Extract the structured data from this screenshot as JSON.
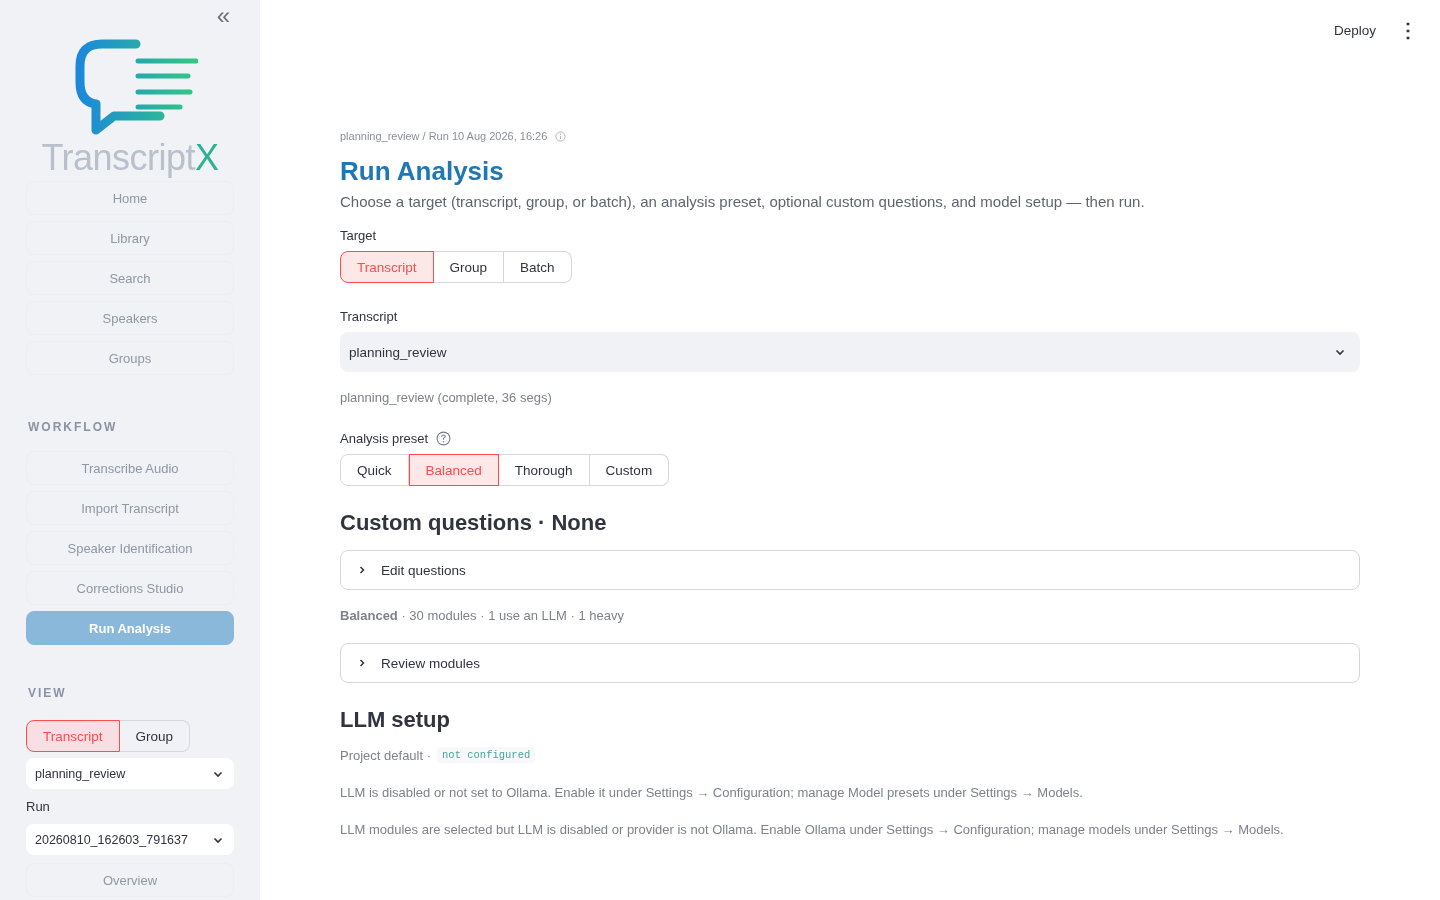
{
  "sidebar": {
    "collapse_icon": "«",
    "logo": {
      "wordmark": "Transcript",
      "accent": "X"
    },
    "nav": [
      {
        "label": "Home",
        "selected": false
      },
      {
        "label": "Library",
        "selected": false
      },
      {
        "label": "Search",
        "selected": false
      },
      {
        "label": "Speakers",
        "selected": false
      },
      {
        "label": "Groups",
        "selected": false
      }
    ],
    "workflow": {
      "title": "WORKFLOW",
      "items": [
        {
          "label": "Transcribe Audio",
          "selected": false
        },
        {
          "label": "Import Transcript",
          "selected": false
        },
        {
          "label": "Speaker Identification",
          "selected": false
        },
        {
          "label": "Corrections Studio",
          "selected": false
        },
        {
          "label": "Run Analysis",
          "selected": true
        }
      ]
    },
    "view": {
      "title": "VIEW",
      "tabs": [
        {
          "label": "Transcript",
          "selected": true
        },
        {
          "label": "Group",
          "selected": false
        }
      ],
      "transcript_select": "planning_review",
      "run_label": "Run",
      "run_select": "20260810_162603_791637",
      "next_item": "Overview"
    }
  },
  "header": {
    "deploy": "Deploy",
    "menu_icon": "⋮"
  },
  "breadcrumb": "planning_review / Run 10 Aug 2026, 16:26",
  "title": "Run Analysis",
  "subtitle": "Choose a target (transcript, group, or batch), an analysis preset, optional custom questions, and model setup — then run.",
  "target": {
    "label": "Target",
    "options": [
      {
        "label": "Transcript",
        "selected": true
      },
      {
        "label": "Group",
        "selected": false
      },
      {
        "label": "Batch",
        "selected": false
      }
    ]
  },
  "transcript": {
    "label": "Transcript",
    "value": "planning_review",
    "caption": "planning_review (complete, 36 segs)"
  },
  "preset": {
    "label": "Analysis preset",
    "options": [
      {
        "label": "Quick",
        "selected": false
      },
      {
        "label": "Balanced",
        "selected": true
      },
      {
        "label": "Thorough",
        "selected": false
      },
      {
        "label": "Custom",
        "selected": false
      }
    ]
  },
  "custom_questions": {
    "heading": "Custom questions · None",
    "expander": {
      "label": "Edit questions",
      "expanded": false
    }
  },
  "summary": "**Balanced** · 30 modules · 1 use an LLM · 1 heavy",
  "modules_expander": {
    "label": "Review modules",
    "expanded": false
  },
  "llm": {
    "heading": "LLM setup",
    "project_default": "Project default ·",
    "status_code": "not configured",
    "notes": [
      "LLM is disabled or not set to Ollama. Enable it under Settings → Configuration; manage Model presets under Settings → Models.",
      "LLM modules are selected but LLM is disabled or provider is not Ollama. Enable Ollama under Settings → Configuration; manage models under Settings → Models."
    ]
  }
}
